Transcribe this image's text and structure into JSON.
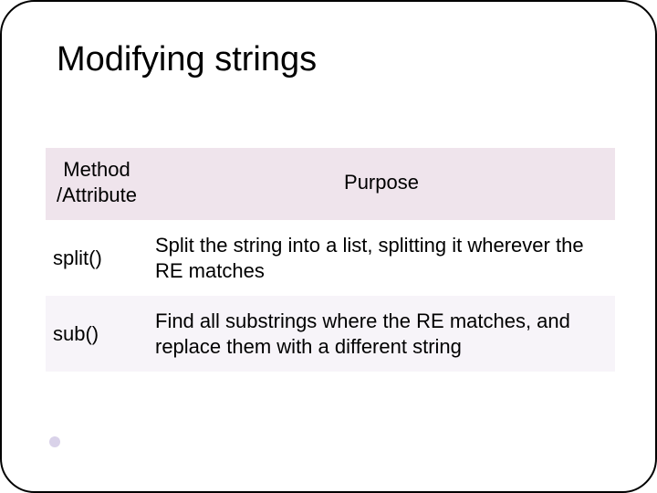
{
  "title": "Modifying strings",
  "headers": {
    "method": "Method /Attribute",
    "purpose": "Purpose"
  },
  "rows": [
    {
      "method": "split()",
      "purpose": "Split the string into a list, splitting it wherever the RE matches"
    },
    {
      "method": "sub()",
      "purpose": "Find all substrings where the RE matches, and replace them with a different string"
    }
  ]
}
